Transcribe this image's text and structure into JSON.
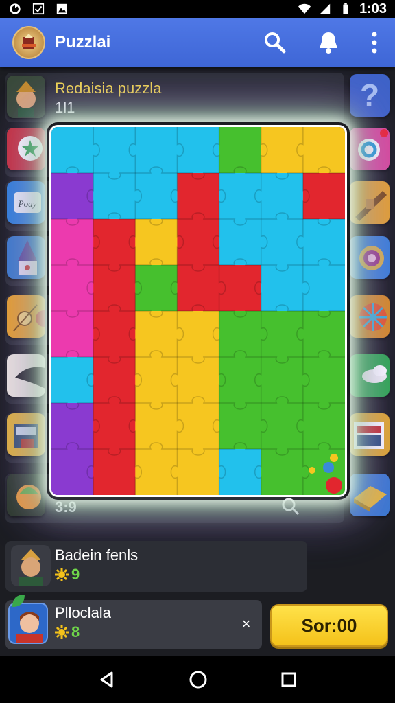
{
  "status_bar": {
    "time": "1:03",
    "icons": [
      "sync-icon",
      "checkbox-icon",
      "gallery-icon",
      "wifi-icon",
      "signal-icon",
      "battery-icon"
    ]
  },
  "app_bar": {
    "title": "Puzzlai",
    "actions": [
      "search-icon",
      "bell-icon",
      "more-vert-icon"
    ]
  },
  "featured": {
    "title": "Redaisia puzzla",
    "score": "1l1",
    "bottom_score": "3:9",
    "help_label": "?",
    "thumb_label": "Poay"
  },
  "friend": {
    "name": "Badein fenls",
    "coins": "9"
  },
  "player": {
    "name": "Plloclala",
    "coins": "8",
    "close_label": "×",
    "score_button": "Sor:00"
  },
  "colors": {
    "appbar": "#4f78e6",
    "accent_yellow": "#f4d94a",
    "coin_green": "#6fd64a"
  },
  "puzzle_grid": [
    [
      "c",
      "c",
      "c",
      "c",
      "g",
      "y",
      "y"
    ],
    [
      "p",
      "c",
      "c",
      "r",
      "c",
      "c",
      "r"
    ],
    [
      "m",
      "r",
      "y",
      "r",
      "c",
      "c",
      "c"
    ],
    [
      "m",
      "r",
      "g",
      "r",
      "r",
      "c",
      "c"
    ],
    [
      "m",
      "r",
      "y",
      "y",
      "g",
      "g",
      "g"
    ],
    [
      "c",
      "r",
      "y",
      "y",
      "g",
      "g",
      "g"
    ],
    [
      "p",
      "r",
      "y",
      "y",
      "g",
      "g",
      "g"
    ],
    [
      "p",
      "r",
      "y",
      "y",
      "c",
      "g",
      "g"
    ]
  ]
}
